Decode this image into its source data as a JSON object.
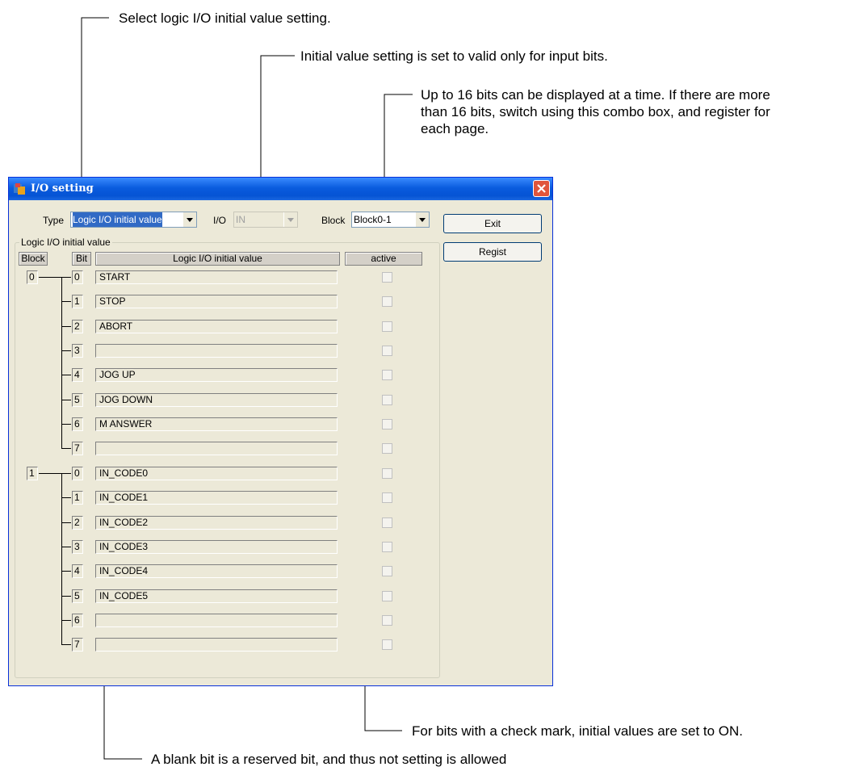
{
  "callouts": {
    "type_note": "Select logic I/O initial value setting.",
    "io_note": "Initial value setting is set to valid only for input bits.",
    "block_note_line1": "Up to 16 bits can be displayed at a time. If there are more",
    "block_note_line2": "than 16 bits, switch using this combo box, and register for",
    "block_note_line3": "each page.",
    "check_note": "For bits with a check mark, initial values are set to ON.",
    "blank_note": "A blank bit is a reserved bit, and thus not setting is allowed"
  },
  "window": {
    "title": "I/O setting",
    "type_label": "Type",
    "type_value": "Logic I/O initial value",
    "io_label": "I/O",
    "io_value": "IN",
    "block_label": "Block",
    "block_value": "Block0-1",
    "exit_label": "Exit",
    "regist_label": "Regist",
    "group_title": "Logic I/O initial value",
    "headers": {
      "block": "Block",
      "bit": "Bit",
      "value": "Logic I/O initial value",
      "active": "active"
    }
  },
  "blocks": [
    {
      "number": "0",
      "bits": [
        {
          "bit": "0",
          "value": "START",
          "active": false
        },
        {
          "bit": "1",
          "value": "STOP",
          "active": false
        },
        {
          "bit": "2",
          "value": "ABORT",
          "active": false
        },
        {
          "bit": "3",
          "value": "",
          "active": false
        },
        {
          "bit": "4",
          "value": "JOG UP",
          "active": false
        },
        {
          "bit": "5",
          "value": "JOG DOWN",
          "active": false
        },
        {
          "bit": "6",
          "value": "M ANSWER",
          "active": false
        },
        {
          "bit": "7",
          "value": "",
          "active": false
        }
      ]
    },
    {
      "number": "1",
      "bits": [
        {
          "bit": "0",
          "value": "IN_CODE0",
          "active": false
        },
        {
          "bit": "1",
          "value": "IN_CODE1",
          "active": false
        },
        {
          "bit": "2",
          "value": "IN_CODE2",
          "active": false
        },
        {
          "bit": "3",
          "value": "IN_CODE3",
          "active": false
        },
        {
          "bit": "4",
          "value": "IN_CODE4",
          "active": false
        },
        {
          "bit": "5",
          "value": "IN_CODE5",
          "active": false
        },
        {
          "bit": "6",
          "value": "",
          "active": false
        },
        {
          "bit": "7",
          "value": "",
          "active": false
        }
      ]
    }
  ],
  "colors": {
    "titlebar": "#0a5cde",
    "window_bg": "#ece9d8",
    "close": "#e0553b"
  }
}
